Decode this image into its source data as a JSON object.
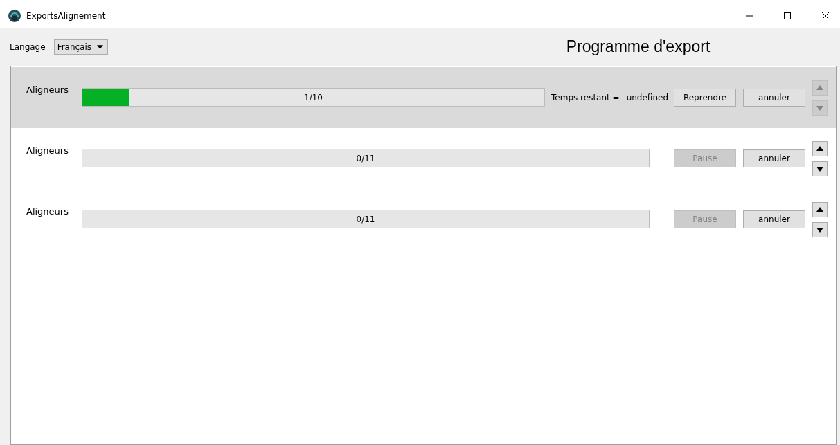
{
  "window": {
    "title": "ExportsAlignement"
  },
  "toolbar": {
    "language_label": "Langage",
    "language_value": "Français",
    "heading": "Programme d'export"
  },
  "tasks": [
    {
      "label": "Aligneurs",
      "progress_text": "1/10",
      "level": 0.1,
      "selected": true,
      "time_label": "Temps restant =",
      "time_value": "undefined",
      "action": {
        "label": "Reprendre",
        "disabled": false
      },
      "cancel": "annuler",
      "move_disabled": true
    },
    {
      "label": "Aligneurs",
      "progress_text": "0/11",
      "level": 0,
      "selected": false,
      "action": {
        "label": "Pause",
        "disabled": true
      },
      "cancel": "annuler",
      "move_disabled": false
    },
    {
      "label": "Aligneurs",
      "progress_text": "0/11",
      "level": 0,
      "selected": false,
      "action": {
        "label": "Pause",
        "disabled": true
      },
      "cancel": "annuler",
      "move_disabled": false
    }
  ]
}
